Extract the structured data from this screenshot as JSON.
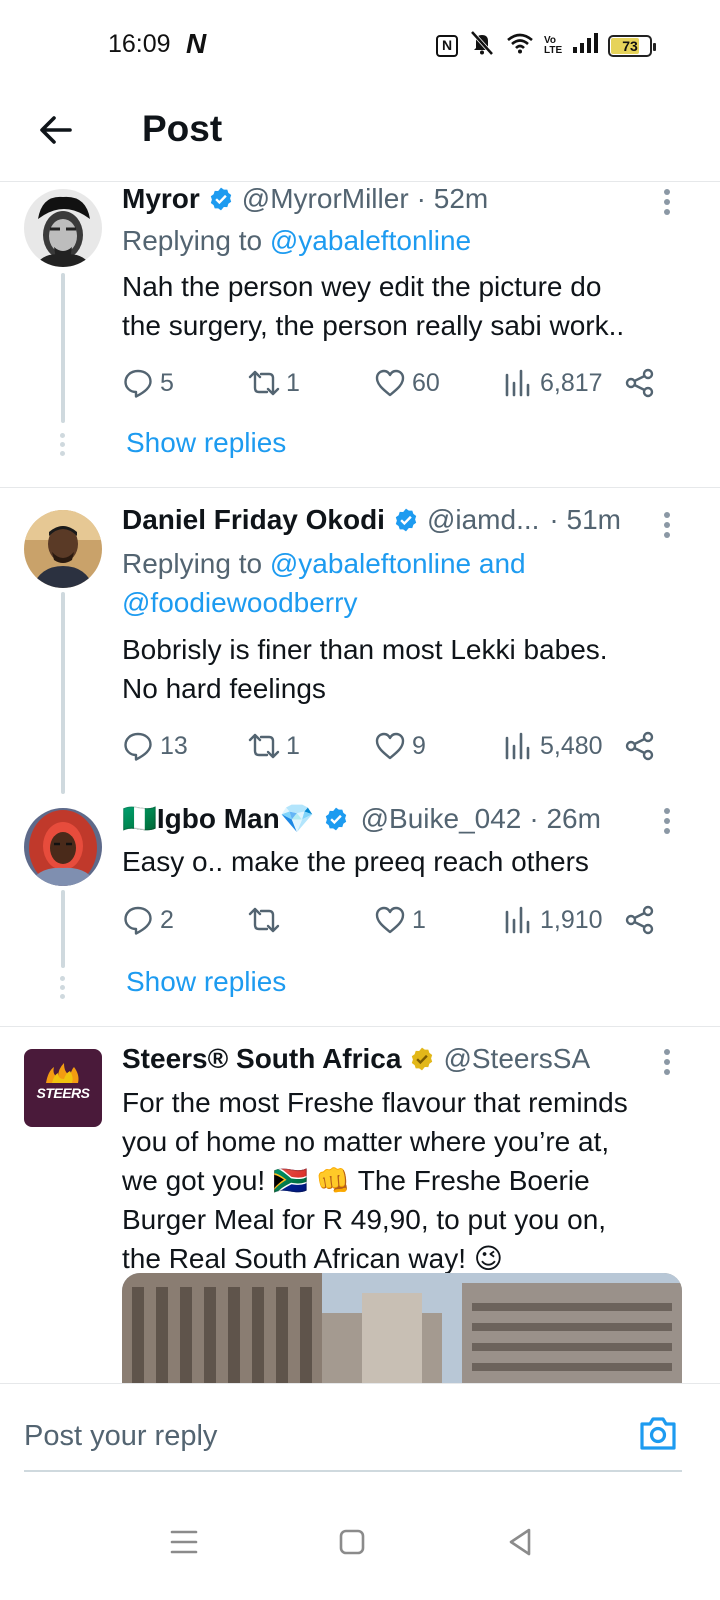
{
  "status_bar": {
    "time": "16:09",
    "app_indicator": "N",
    "nfc": "N",
    "volte": "Vo LTE",
    "battery": "73"
  },
  "header": {
    "title": "Post"
  },
  "tweets": [
    {
      "name": "Myror",
      "handle": "@MyrorMiller",
      "time": "· 52m",
      "replying_prefix": "Replying to ",
      "replying_to": "@yabaleftonline",
      "text_lines": [
        "Nah the person wey edit the picture do",
        "the surgery, the person really sabi work.."
      ],
      "replies": "5",
      "reposts": "1",
      "likes": "60",
      "views": "6,817",
      "show_replies": "Show replies"
    },
    {
      "name": "Daniel Friday Okodi",
      "handle": "@iamd...",
      "time": "· 51m",
      "replying_prefix": "Replying to ",
      "replying_to": "@yabaleftonline and",
      "replying_to_2": "@foodiewoodberry",
      "text_lines": [
        "Bobrisly is finer than most Lekki babes.",
        "No hard feelings"
      ],
      "replies": "13",
      "reposts": "1",
      "likes": "9",
      "views": "5,480"
    },
    {
      "name": "🇳🇬Igbo Man💎",
      "handle": "@Buike_042",
      "time": "· 26m",
      "text_lines": [
        "Easy o.. make the preeq reach others"
      ],
      "replies": "2",
      "reposts": "",
      "likes": "1",
      "views": "1,910",
      "show_replies": "Show replies"
    },
    {
      "name": "Steers® South Africa",
      "handle": "@SteersSA",
      "avatar_label": "STEERS",
      "text_lines": [
        "For the most Freshe flavour that reminds",
        "you of home no matter where you’re at,",
        "we got you! 🇿🇦 👊 The Freshe Boerie",
        "Burger Meal for R 49,90, to put you on,",
        "the Real South African way! 😉"
      ]
    }
  ],
  "reply_bar": {
    "placeholder": "Post your reply"
  },
  "colors": {
    "accent": "#1d9bf0",
    "text": "#0f1419",
    "secondary": "#536471",
    "gold_badge": "#e2b719",
    "steers_brand": "#4a1a3a"
  }
}
